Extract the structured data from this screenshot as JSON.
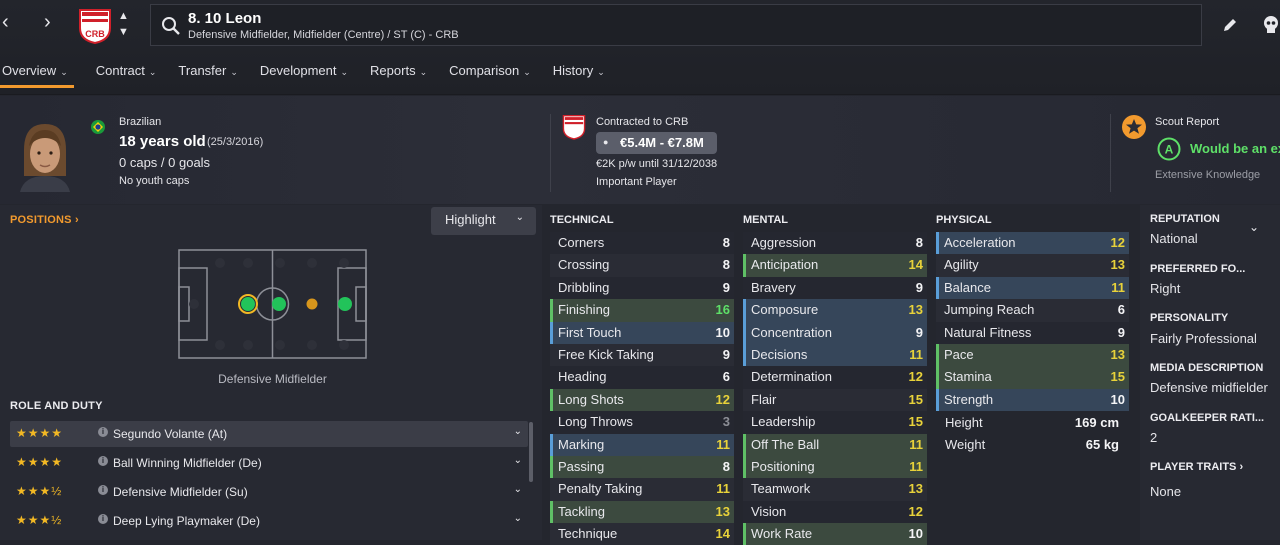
{
  "header": {
    "player_title": "8. 10 Leon",
    "positions_line": "Defensive Midfielder, Midfielder (Centre) / ST (C) - CRB",
    "back_arrow": "‹",
    "forward_arrow": "›",
    "club_crest_text": "CRB"
  },
  "tabs": [
    {
      "label": "Overview",
      "active": true
    },
    {
      "label": "Contract"
    },
    {
      "label": "Transfer"
    },
    {
      "label": "Development"
    },
    {
      "label": "Reports"
    },
    {
      "label": "Comparison"
    },
    {
      "label": "History"
    }
  ],
  "profile": {
    "nationality": "Brazilian",
    "age": "18 years old",
    "dob": "(25/3/2016)",
    "caps_goals": "0 caps / 0 goals",
    "youth_caps": "No youth caps"
  },
  "contract": {
    "contracted_to": "Contracted to CRB",
    "value_range": "€5.4M - €7.8M",
    "wage_line": "€2K p/w until 31/12/2038",
    "squad_status": "Important Player"
  },
  "scout": {
    "title": "Scout Report",
    "grade": "A",
    "verdict": "Would be an ex",
    "knowledge": "Extensive Knowledge"
  },
  "positions_panel": {
    "title": "POSITIONS",
    "highlight_label": "Highlight",
    "pitch_caption": "Defensive Midfielder"
  },
  "role_duty": {
    "title": "ROLE AND DUTY",
    "roles": [
      {
        "stars": "★★★★",
        "label": "Segundo Volante (At)",
        "rating": 4
      },
      {
        "stars": "★★★★",
        "label": "Ball Winning Midfielder (De)",
        "rating": 4
      },
      {
        "stars": "★★★½",
        "label": "Defensive Midfielder (Su)",
        "rating": 3.5
      },
      {
        "stars": "★★★½",
        "label": "Deep Lying Playmaker (De)",
        "rating": 3.5
      }
    ]
  },
  "attributes": {
    "technical": {
      "title": "TECHNICAL",
      "items": [
        {
          "name": "Corners",
          "value": "8",
          "hl": "",
          "col": "white"
        },
        {
          "name": "Crossing",
          "value": "8",
          "hl": "",
          "col": "white"
        },
        {
          "name": "Dribbling",
          "value": "9",
          "hl": "",
          "col": "white"
        },
        {
          "name": "Finishing",
          "value": "16",
          "hl": "green",
          "col": "green"
        },
        {
          "name": "First Touch",
          "value": "10",
          "hl": "blue",
          "col": "white"
        },
        {
          "name": "Free Kick Taking",
          "value": "9",
          "hl": "",
          "col": "white"
        },
        {
          "name": "Heading",
          "value": "6",
          "hl": "",
          "col": "white"
        },
        {
          "name": "Long Shots",
          "value": "12",
          "hl": "green",
          "col": "yellow"
        },
        {
          "name": "Long Throws",
          "value": "3",
          "hl": "",
          "col": "grey"
        },
        {
          "name": "Marking",
          "value": "11",
          "hl": "blue",
          "col": "yellow"
        },
        {
          "name": "Passing",
          "value": "8",
          "hl": "green",
          "col": "white"
        },
        {
          "name": "Penalty Taking",
          "value": "11",
          "hl": "",
          "col": "yellow"
        },
        {
          "name": "Tackling",
          "value": "13",
          "hl": "green",
          "col": "yellow"
        },
        {
          "name": "Technique",
          "value": "14",
          "hl": "",
          "col": "yellow"
        }
      ]
    },
    "mental": {
      "title": "MENTAL",
      "items": [
        {
          "name": "Aggression",
          "value": "8",
          "hl": "",
          "col": "white"
        },
        {
          "name": "Anticipation",
          "value": "14",
          "hl": "green",
          "col": "yellow"
        },
        {
          "name": "Bravery",
          "value": "9",
          "hl": "",
          "col": "white"
        },
        {
          "name": "Composure",
          "value": "13",
          "hl": "blue",
          "col": "yellow"
        },
        {
          "name": "Concentration",
          "value": "9",
          "hl": "blue",
          "col": "white"
        },
        {
          "name": "Decisions",
          "value": "11",
          "hl": "blue",
          "col": "yellow"
        },
        {
          "name": "Determination",
          "value": "12",
          "hl": "",
          "col": "yellow"
        },
        {
          "name": "Flair",
          "value": "15",
          "hl": "",
          "col": "yellow"
        },
        {
          "name": "Leadership",
          "value": "15",
          "hl": "",
          "col": "yellow"
        },
        {
          "name": "Off The Ball",
          "value": "11",
          "hl": "green",
          "col": "yellow"
        },
        {
          "name": "Positioning",
          "value": "11",
          "hl": "green",
          "col": "yellow"
        },
        {
          "name": "Teamwork",
          "value": "13",
          "hl": "",
          "col": "yellow"
        },
        {
          "name": "Vision",
          "value": "12",
          "hl": "",
          "col": "yellow"
        },
        {
          "name": "Work Rate",
          "value": "10",
          "hl": "green",
          "col": "white"
        }
      ]
    },
    "physical": {
      "title": "PHYSICAL",
      "items": [
        {
          "name": "Acceleration",
          "value": "12",
          "hl": "blue",
          "col": "yellow"
        },
        {
          "name": "Agility",
          "value": "13",
          "hl": "",
          "col": "yellow"
        },
        {
          "name": "Balance",
          "value": "11",
          "hl": "blue",
          "col": "yellow"
        },
        {
          "name": "Jumping Reach",
          "value": "6",
          "hl": "",
          "col": "white"
        },
        {
          "name": "Natural Fitness",
          "value": "9",
          "hl": "",
          "col": "white"
        },
        {
          "name": "Pace",
          "value": "13",
          "hl": "green",
          "col": "yellow"
        },
        {
          "name": "Stamina",
          "value": "15",
          "hl": "green",
          "col": "yellow"
        },
        {
          "name": "Strength",
          "value": "10",
          "hl": "blue",
          "col": "white"
        }
      ],
      "height_label": "Height",
      "height_value": "169 cm",
      "weight_label": "Weight",
      "weight_value": "65 kg"
    }
  },
  "right_panel": {
    "reputation_title": "REPUTATION",
    "reputation_value": "National",
    "foot_title": "PREFERRED FO...",
    "foot_value": "Right",
    "personality_title": "PERSONALITY",
    "personality_value": "Fairly Professional",
    "media_title": "MEDIA DESCRIPTION",
    "media_value": "Defensive midfielder",
    "gk_title": "GOALKEEPER RATI...",
    "gk_value": "2",
    "traits_title": "PLAYER TRAITS",
    "traits_value": "None"
  },
  "colors": {
    "accent_orange": "#f29a2e",
    "attr_green": "#5ee068",
    "attr_yellow": "#e8d23a",
    "scout_green": "#5ee068",
    "star_gold": "#f2b824"
  }
}
